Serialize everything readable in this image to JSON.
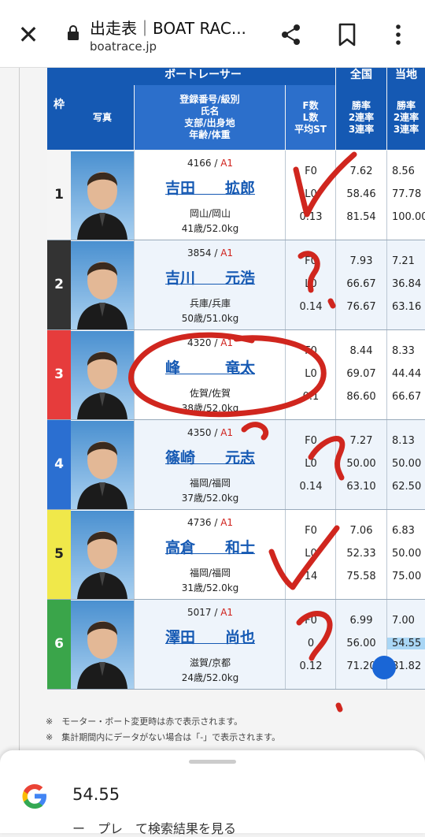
{
  "browser": {
    "title": "出走表｜BOAT RAC...",
    "url": "boatrace.jp",
    "close_icon": "close-icon",
    "share_icon": "share-icon",
    "bookmark_icon": "bookmark-icon",
    "menu_icon": "more-vert-icon"
  },
  "table": {
    "waku_header": "枠",
    "group_header": "ボートレーサー",
    "zenkoku_header": "全国",
    "touchi_header": "当地",
    "photo_header": "写真",
    "info_header": [
      "登録番号/級別",
      "氏名",
      "支部/出身地",
      "年齢/体重"
    ],
    "st_header": [
      "F数",
      "L数",
      "平均ST"
    ],
    "rate_header": [
      "勝率",
      "2連率",
      "3連率"
    ],
    "rate_header2": [
      "勝率",
      "2連率",
      "3連率"
    ],
    "racers": [
      {
        "waku": "1",
        "color": "#f5f5f5",
        "text_color": "#222222",
        "reg": "4166 / ",
        "cls": "A1",
        "name": "吉田　　拡郎",
        "place": "岡山/岡山",
        "age": "41歳/52.0kg",
        "f": "F0",
        "l": "L0",
        "st": "0.13",
        "z1": "7.62",
        "z2": "58.46",
        "z3": "81.54",
        "t1": "8.56",
        "t2": "77.78",
        "t3": "100.00"
      },
      {
        "waku": "2",
        "color": "#333333",
        "text_color": "#ffffff",
        "reg": "3854 / ",
        "cls": "A1",
        "name": "吉川　　元浩",
        "place": "兵庫/兵庫",
        "age": "50歳/51.0kg",
        "f": "F0",
        "l": "L0",
        "st": "0.14",
        "z1": "7.93",
        "z2": "66.67",
        "z3": "76.67",
        "t1": "7.21",
        "t2": "36.84",
        "t3": "63.16"
      },
      {
        "waku": "3",
        "color": "#e63c3c",
        "text_color": "#ffffff",
        "reg": "4320 / ",
        "cls": "A1",
        "name": "峰　　　竜太",
        "place": "佐賀/佐賀",
        "age": "38歳/52.0kg",
        "f": "F0",
        "l": "L0",
        "st": "0.1",
        "z1": "8.44",
        "z2": "69.07",
        "z3": "86.60",
        "t1": "8.33",
        "t2": "44.44",
        "t3": "66.67"
      },
      {
        "waku": "4",
        "color": "#2b6fd1",
        "text_color": "#ffffff",
        "reg": "4350 / ",
        "cls": "A1",
        "name": "篠崎　　元志",
        "place": "福岡/福岡",
        "age": "37歳/52.0kg",
        "f": "F0",
        "l": "L0",
        "st": "0.14",
        "z1": "7.27",
        "z2": "50.00",
        "z3": "63.10",
        "t1": "8.13",
        "t2": "50.00",
        "t3": "62.50"
      },
      {
        "waku": "5",
        "color": "#f0e84a",
        "text_color": "#222222",
        "reg": "4736 / ",
        "cls": "A1",
        "name": "高倉　　和士",
        "place": "福岡/福岡",
        "age": "31歳/52.0kg",
        "f": "F0",
        "l": "L0",
        "st": "14",
        "z1": "7.06",
        "z2": "52.33",
        "z3": "75.58",
        "t1": "6.83",
        "t2": "50.00",
        "t3": "75.00"
      },
      {
        "waku": "6",
        "color": "#3aa54a",
        "text_color": "#ffffff",
        "reg": "5017 / ",
        "cls": "A1",
        "name": "澤田　　尚也",
        "place": "滋賀/京都",
        "age": "24歳/52.0kg",
        "f": "F0",
        "l": "0",
        "st": "0.12",
        "z1": "6.99",
        "z2": "56.00",
        "z3": "71.20",
        "t1": "7.00",
        "t2": "54.55",
        "t3": "81.82"
      }
    ]
  },
  "notes": [
    "※　モーター・ボート変更時は赤で表示されます。",
    "※　集計期間内にデータがない場合は「-」で表示されます。"
  ],
  "sheet": {
    "value": "54.55",
    "sub": "ー　プレ　て検索結果を見る"
  },
  "colors": {
    "header_blue": "#1559b3",
    "link_blue": "#1559b3",
    "class_red": "#d0201b",
    "ink_red": "#d0261e",
    "highlight": "#a9d6f5"
  }
}
